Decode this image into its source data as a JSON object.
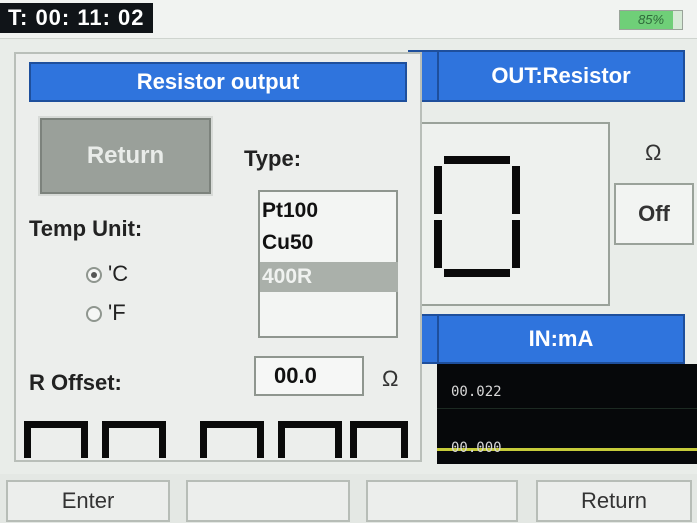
{
  "status": {
    "timer": "T: 00: 11: 02",
    "battery": "85%",
    "battery_level": 0.85
  },
  "right_panel": {
    "output_header": "OUT:Resistor",
    "display_value": "0",
    "unit": "Ω",
    "toggle_label": "Off",
    "input_header": "IN:mA",
    "trend_upper": "00.022",
    "trend_lower": "00.000"
  },
  "dialog": {
    "title": "Resistor output",
    "return_label": "Return",
    "type_label": "Type:",
    "types": [
      "Pt100",
      "Cu50",
      "400R"
    ],
    "selected_type": "400R",
    "temp_unit_label": "Temp Unit:",
    "temp_units": [
      {
        "label": "'C",
        "selected": true
      },
      {
        "label": "'F",
        "selected": false
      }
    ],
    "offset_label": "R Offset:",
    "offset_value": "00.0",
    "offset_unit": "Ω"
  },
  "softkeys": {
    "key1": "Enter",
    "key2": "",
    "key3": "",
    "key4": "Return"
  },
  "colors": {
    "header_blue": "#2f74dd",
    "trend_line": "#c6cc3a",
    "battery_green": "#6fcf78"
  }
}
